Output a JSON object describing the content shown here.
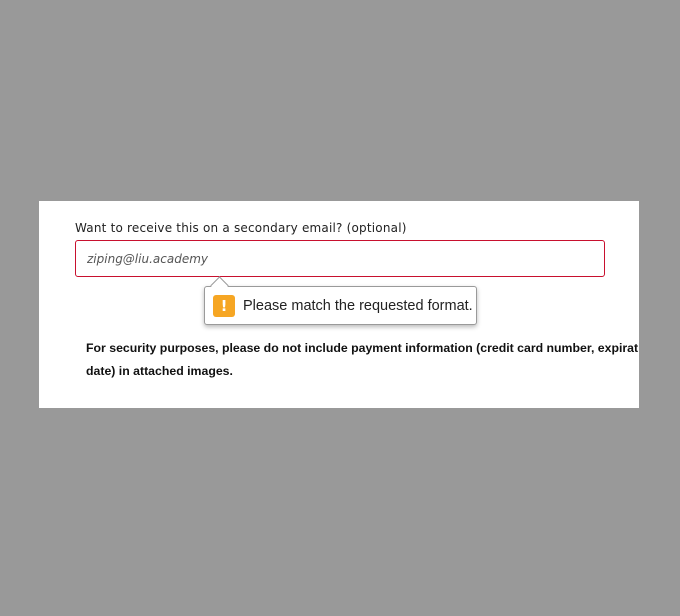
{
  "form": {
    "secondary_email_label": "Want to receive this on a secondary email? (optional)",
    "secondary_email_value": "ziping@liu.academy",
    "secondary_email_placeholder": "",
    "validation_message": "Please match the requested format.",
    "validation_icon": "warning-icon",
    "invalid_border_color": "#c8102e",
    "warning_color": "#f6a623"
  },
  "notice": {
    "security_text": "For security purposes, please do not include payment information (credit card number, expiration date) in attached images."
  }
}
